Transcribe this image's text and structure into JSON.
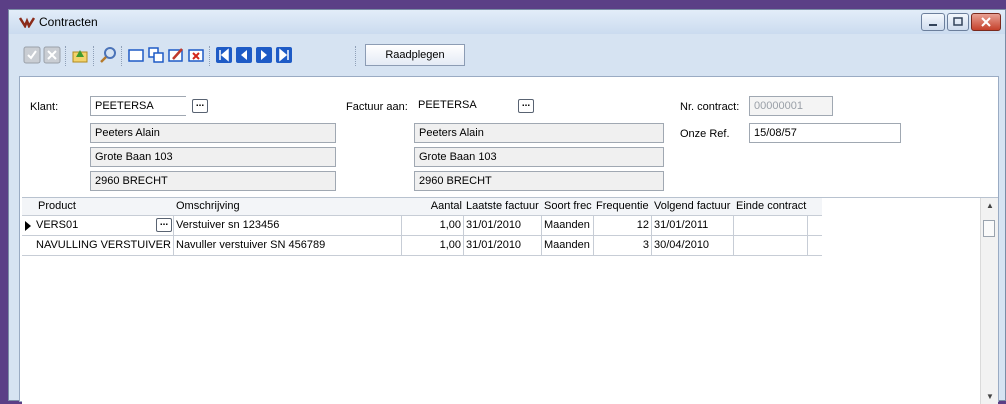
{
  "window": {
    "title": "Contracten"
  },
  "toolbar": {
    "mode_button": "Raadplegen"
  },
  "form": {
    "klant": {
      "label": "Klant:",
      "code": "PEETERSA",
      "name": "Peeters Alain",
      "street": "Grote Baan 103",
      "city": "2960 BRECHT"
    },
    "factuur": {
      "label": "Factuur aan:",
      "code": "PEETERSA",
      "name": "Peeters Alain",
      "street": "Grote Baan 103",
      "city": "2960 BRECHT"
    },
    "contract_nr": {
      "label": "Nr. contract:",
      "value": "00000001"
    },
    "onze_ref": {
      "label": "Onze Ref.",
      "value": "15/08/57"
    }
  },
  "grid": {
    "headers": [
      "Product",
      "Omschrijving",
      "Aantal",
      "Laatste factuur",
      "Soort frec",
      "Frequentie",
      "Volgend factuur",
      "Einde contract"
    ],
    "rows": [
      [
        "VERS01",
        "Verstuiver sn 123456",
        "1,00",
        "31/01/2010",
        "Maanden",
        "12",
        "31/01/2011",
        ""
      ],
      [
        "NAVULLING VERSTUIVER",
        "Navuller verstuiver SN 456789",
        "1,00",
        "31/01/2010",
        "Maanden",
        "3",
        "30/04/2010",
        ""
      ]
    ]
  },
  "icons": [
    "check-icon",
    "cancel-icon",
    "export-icon",
    "search-icon",
    "new-icon",
    "copy-icon",
    "edit-icon",
    "delete-icon",
    "first-icon",
    "prev-icon",
    "next-icon",
    "last-icon"
  ],
  "colors": {
    "accent_blue": "#1e5bc6",
    "window_bg": "#d6e3f2"
  }
}
